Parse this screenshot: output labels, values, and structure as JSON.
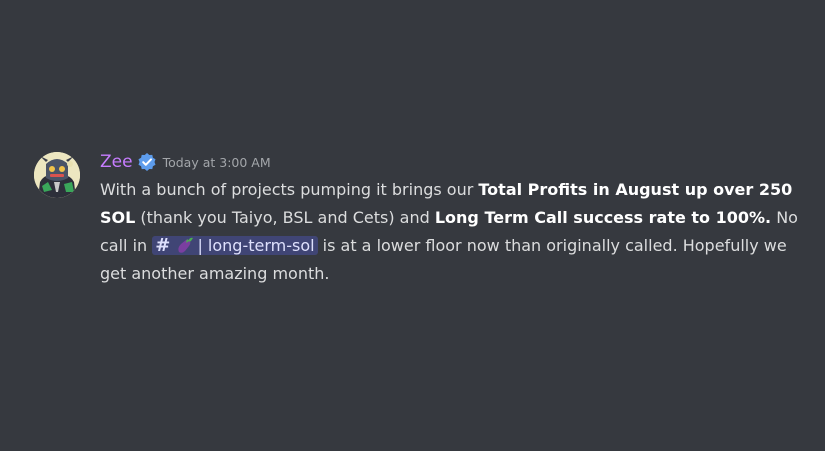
{
  "message": {
    "username": "Zee",
    "timestamp": "Today at 3:00 AM",
    "verified_icon": "verified-badge-icon",
    "avatar_icon": "user-avatar",
    "parts": {
      "p1": "With a bunch of projects pumping it brings our ",
      "b1": "Total Profits in August up over 250 SOL",
      "p2": " (thank you Taiyo, BSL and Cets) and ",
      "b2": "Long Term Call success rate to 100%.",
      "p3": " No call in ",
      "hash": "#",
      "channel": "| long-term-sol",
      "p4": " is at a lower floor now than originally called. Hopefully we get another amazing month."
    },
    "channel_emoji": "eggplant-icon"
  },
  "colors": {
    "background": "#36393f",
    "username": "#c77dff",
    "text": "#dcddde",
    "mention_bg": "#5865f24d",
    "verified": "#5d9cec"
  }
}
